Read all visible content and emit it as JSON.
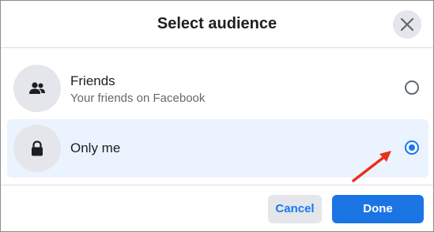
{
  "dialog": {
    "title": "Select audience",
    "close_icon": "close-icon"
  },
  "options": [
    {
      "label": "Friends",
      "description": "Your friends on Facebook",
      "icon": "friends-icon",
      "selected": false
    },
    {
      "label": "Only me",
      "icon": "lock-icon",
      "selected": true
    }
  ],
  "footer": {
    "cancel_label": "Cancel",
    "done_label": "Done"
  },
  "colors": {
    "accent": "#1877f2",
    "selected_row_bg": "#ebf3ff",
    "annotation_arrow": "#e8321e"
  }
}
